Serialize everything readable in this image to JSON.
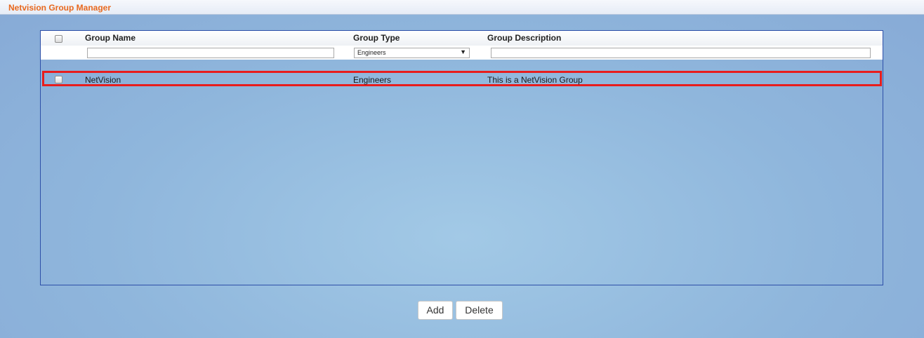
{
  "window": {
    "title": "Netvision Group Manager"
  },
  "table": {
    "headers": {
      "name": "Group Name",
      "type": "Group Type",
      "description": "Group Description"
    },
    "filters": {
      "name_value": "",
      "type_selected": "Engineers",
      "description_value": ""
    },
    "rows": [
      {
        "name": "NetVision",
        "type": "Engineers",
        "description": "This is a NetVision Group",
        "selected": false,
        "highlighted": true
      }
    ]
  },
  "actions": {
    "add_label": "Add",
    "delete_label": "Delete"
  },
  "colors": {
    "title_text": "#e8681e",
    "panel_border": "#2d4fa8",
    "row_highlight": "#e81d1d"
  },
  "icons": {
    "dropdown": "triangle-down-icon"
  }
}
